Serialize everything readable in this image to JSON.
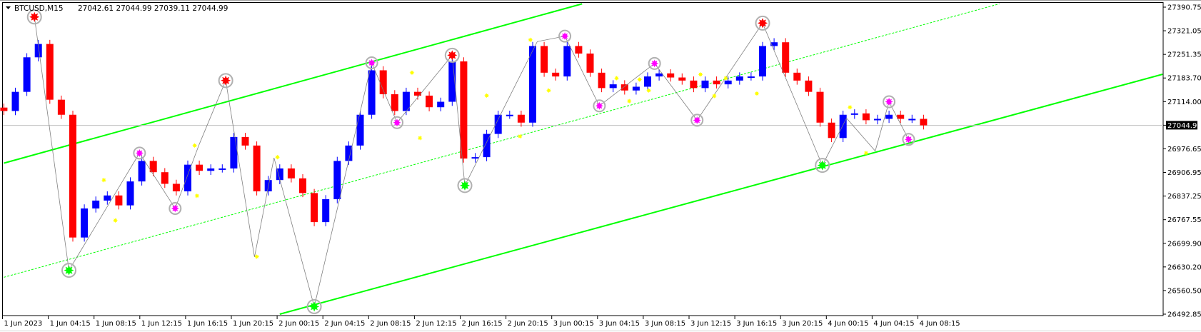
{
  "header": {
    "symbol": "BTCUSD,M15",
    "ohlc": "27042.61 27044.99 27039.11 27044.99"
  },
  "colors": {
    "up": "#0000ff",
    "down": "#ff0000",
    "channel": "#00ff00",
    "zigzag": "#808080",
    "top_marker": "#ff0000",
    "bottom_marker": "#00ff00",
    "swing_marker": "#ff00ff",
    "minor_marker": "#ffff00",
    "price_line": "#c0c0c0"
  },
  "chart_data": {
    "type": "candlestick",
    "title": "BTCUSD,M15",
    "x_unit": "hours since 1 Jun 2023 00:00",
    "ylim": [
      26492.85,
      27390.75
    ],
    "y_ticks": [
      "27390.75",
      "27321.05",
      "27251.35",
      "27183.70",
      "27114.00",
      "27044.99",
      "26976.65",
      "26906.95",
      "26837.25",
      "26767.55",
      "26699.90",
      "26630.20",
      "26560.50",
      "26492.85"
    ],
    "current_price": "27044.99",
    "x_ticks": [
      "1 Jun 2023",
      "1 Jun 04:15",
      "1 Jun 08:15",
      "1 Jun 12:15",
      "1 Jun 16:15",
      "1 Jun 20:15",
      "2 Jun 00:15",
      "2 Jun 04:15",
      "2 Jun 08:15",
      "2 Jun 12:15",
      "2 Jun 16:15",
      "2 Jun 20:15",
      "3 Jun 00:15",
      "3 Jun 04:15",
      "3 Jun 08:15",
      "3 Jun 12:15",
      "3 Jun 16:15",
      "3 Jun 20:15",
      "4 Jun 00:15",
      "4 Jun 04:15",
      "4 Jun 08:15"
    ],
    "hourly_close": [
      27087,
      27143,
      27244,
      27283,
      27120,
      27076,
      26717,
      26802,
      26825,
      26840,
      26811,
      26881,
      26941,
      26908,
      26874,
      26852,
      26930,
      26912,
      26919,
      26919,
      27011,
      26986,
      26852,
      26885,
      26919,
      26890,
      26847,
      26762,
      26829,
      26941,
      26986,
      27076,
      27206,
      27136,
      27087,
      27143,
      27132,
      27098,
      27114,
      27232,
      26948,
      26952,
      27020,
      27076,
      27076,
      27053,
      27277,
      27199,
      27188,
      27277,
      27255,
      27199,
      27154,
      27165,
      27147,
      27158,
      27188,
      27197,
      27185,
      27176,
      27154,
      27176,
      27165,
      27176,
      27188,
      27188,
      27277,
      27288,
      27199,
      27176,
      27143,
      27053,
      27008,
      27076,
      27080,
      27060,
      27064,
      27076,
      27064,
      27064,
      27045
    ],
    "channel": {
      "upper": [
        [
          0,
          26934.5
        ],
        [
          50.3,
          27400.4
        ]
      ],
      "middle": [
        [
          0,
          26600.7
        ],
        [
          86.6,
          27400.4
        ]
      ],
      "lower": [
        [
          24,
          26492.9
        ],
        [
          100.8,
          27194.5
        ]
      ]
    },
    "zigzag": [
      [
        2.66,
        27362
      ],
      [
        5.66,
        26621
      ],
      [
        11.8,
        26964
      ],
      [
        14.9,
        26802
      ],
      [
        17,
        26990
      ],
      [
        19.3,
        27176
      ],
      [
        21.8,
        26660
      ],
      [
        23.5,
        26950
      ],
      [
        27,
        26515
      ],
      [
        32,
        27228
      ],
      [
        34.2,
        27053
      ],
      [
        39,
        27250
      ],
      [
        40.1,
        26869
      ],
      [
        46.4,
        27290
      ],
      [
        48.8,
        27306
      ],
      [
        51.8,
        27102
      ],
      [
        56.6,
        27226
      ],
      [
        60.3,
        27060
      ],
      [
        66,
        27344
      ],
      [
        71.2,
        26928
      ],
      [
        73.3,
        27066
      ],
      [
        75.8,
        26970
      ],
      [
        77,
        27114
      ],
      [
        78.7,
        27004
      ]
    ],
    "markers": {
      "tops": [
        [
          2.66,
          27362
        ],
        [
          19.3,
          27176
        ],
        [
          39,
          27250
        ],
        [
          66,
          27344
        ]
      ],
      "bottoms": [
        [
          5.66,
          26621
        ],
        [
          27,
          26515
        ],
        [
          40.1,
          26869
        ],
        [
          71.2,
          26928
        ]
      ],
      "swing_highs": [
        [
          11.8,
          26964
        ],
        [
          32,
          27228
        ],
        [
          48.8,
          27306
        ],
        [
          56.6,
          27226
        ],
        [
          77,
          27114
        ]
      ],
      "swing_lows": [
        [
          14.9,
          26802
        ],
        [
          34.2,
          27053
        ],
        [
          51.8,
          27102
        ],
        [
          60.3,
          27060
        ],
        [
          78.7,
          27004
        ]
      ],
      "minor": [
        [
          8.7,
          26885
        ],
        [
          9.7,
          26767
        ],
        [
          16.6,
          26986
        ],
        [
          16.8,
          26839
        ],
        [
          22,
          26661
        ],
        [
          23.8,
          26952
        ],
        [
          35.5,
          27199
        ],
        [
          36.2,
          27008
        ],
        [
          42,
          27132
        ],
        [
          44.9,
          27013
        ],
        [
          45.8,
          27295
        ],
        [
          47.4,
          27147
        ],
        [
          53.3,
          27183
        ],
        [
          54.4,
          27116
        ],
        [
          55.3,
          27179
        ],
        [
          56.1,
          27147
        ],
        [
          60.6,
          27194
        ],
        [
          61.8,
          27131
        ],
        [
          62.8,
          27183
        ],
        [
          65.5,
          27138
        ],
        [
          73.6,
          27098
        ],
        [
          75,
          26964
        ]
      ]
    }
  }
}
